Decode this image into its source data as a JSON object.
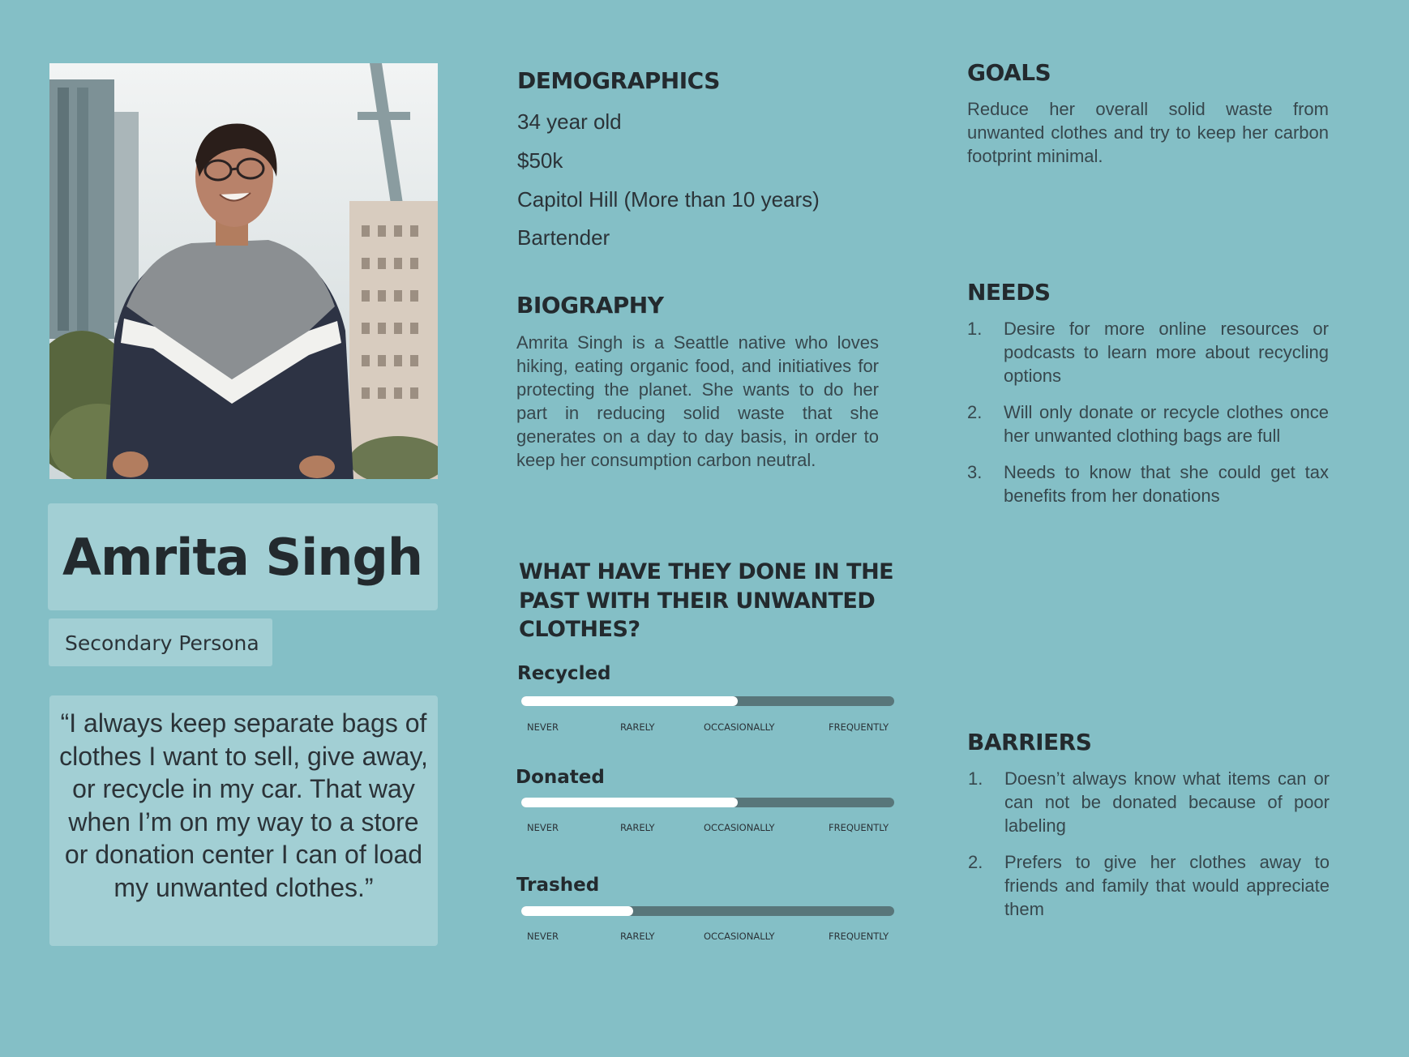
{
  "persona": {
    "name": "Amrita Singh",
    "role": "Secondary Persona",
    "quote": "“I always keep separate bags of clothes I want to sell, give away, or recycle in my car. That way when I’m on my way to a store or donation center I can of load my unwanted clothes.”"
  },
  "demographics": {
    "heading": "DEMOGRAPHICS",
    "items": [
      "34 year old",
      "$50k",
      "Capitol Hill (More than 10 years)",
      "Bartender"
    ]
  },
  "biography": {
    "heading": "BIOGRAPHY",
    "text": "Amrita Singh is a Seattle native who loves hiking, eating organic food, and initiatives for protecting the planet. She wants to do her part in reducing solid waste that she generates on a day to day basis, in order to keep her consumption carbon neutral."
  },
  "past_behavior": {
    "heading": "WHAT HAVE THEY DONE IN THE PAST WITH THEIR UNWANTED CLOTHES?",
    "scale_labels": [
      "NEVER",
      "RARELY",
      "OCCASIONALLY",
      "FREQUENTLY"
    ],
    "ratings": [
      {
        "label": "Recycled",
        "level": 0.58
      },
      {
        "label": "Donated",
        "level": 0.58
      },
      {
        "label": "Trashed",
        "level": 0.3
      }
    ]
  },
  "goals": {
    "heading": "GOALS",
    "text": "Reduce her overall solid waste from unwanted clothes and try to keep her carbon footprint minimal."
  },
  "needs": {
    "heading": "NEEDS",
    "items": [
      {
        "num": "1.",
        "text": "Desire for more online resources or podcasts to learn more about recycling options"
      },
      {
        "num": "2.",
        "text": "Will only donate or recycle clothes once her unwanted clothing bags are full"
      },
      {
        "num": "3.",
        "text": "Needs to know that she could get tax benefits from her donations"
      }
    ]
  },
  "barriers": {
    "heading": "BARRIERS",
    "items": [
      {
        "num": "1.",
        "text": "Doesn’t always know what items can or can not be donated because of poor labeling"
      },
      {
        "num": "2.",
        "text": "Prefers to give her clothes away to friends and family that would appreciate them"
      }
    ]
  }
}
